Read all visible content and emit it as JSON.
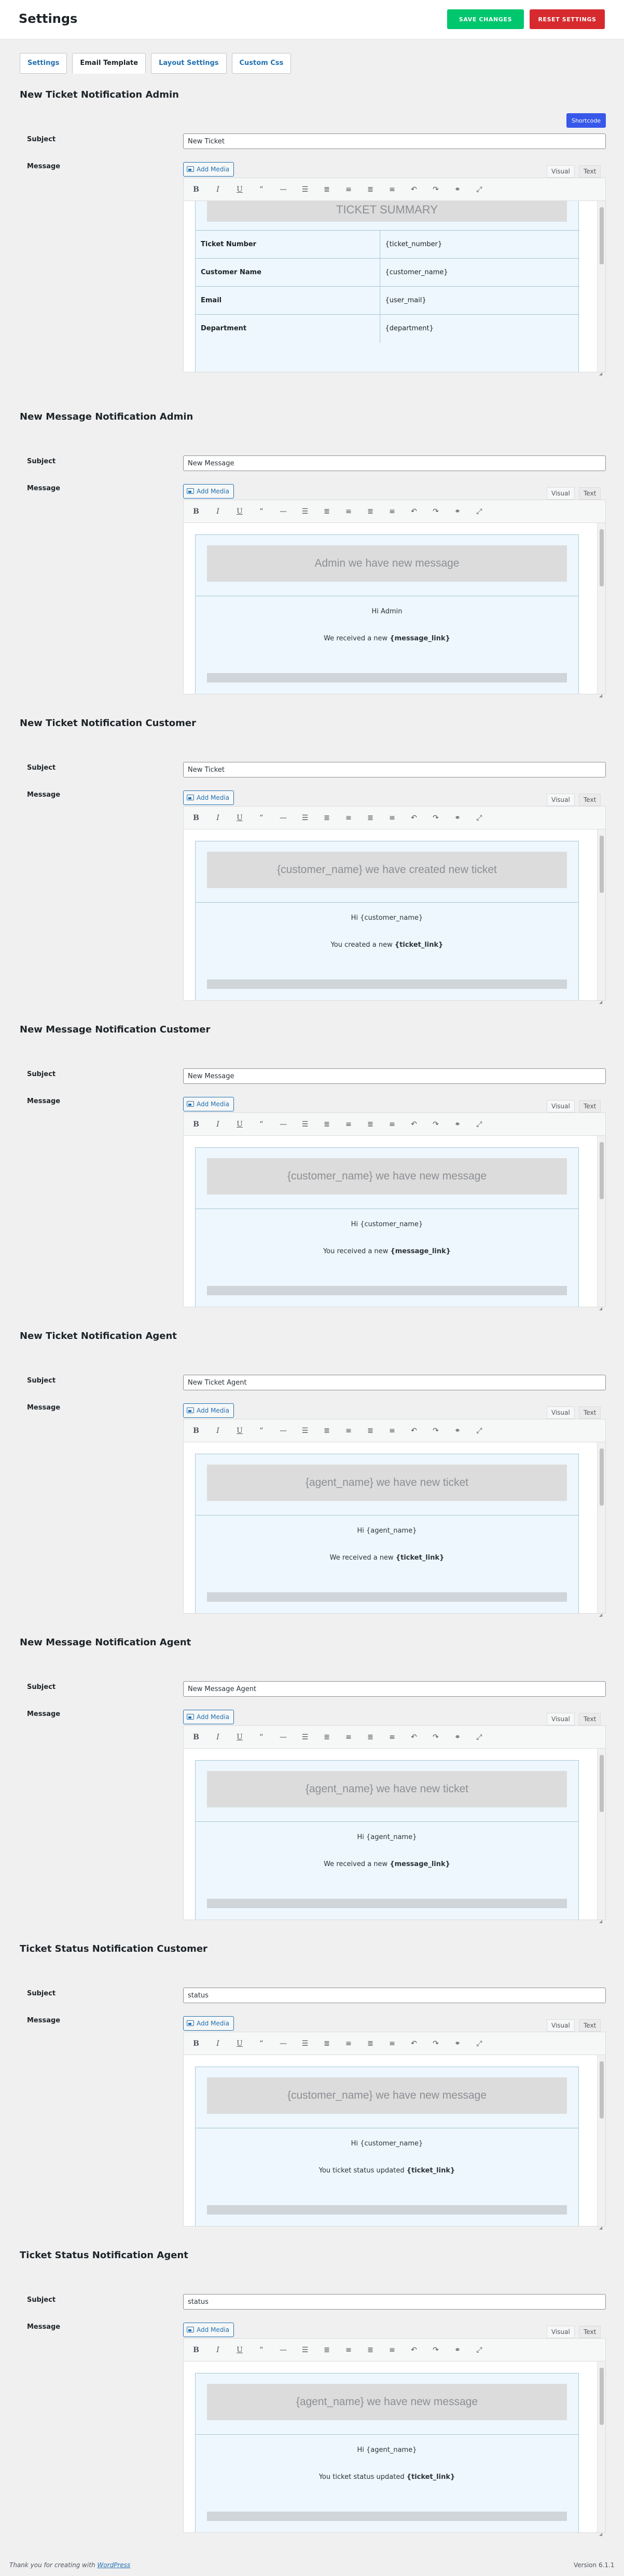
{
  "header": {
    "title": "Settings",
    "save_label": "SAVE CHANGES",
    "reset_label": "RESET SETTINGS"
  },
  "tabs": [
    {
      "label": "Settings"
    },
    {
      "label": "Email Template"
    },
    {
      "label": "Layout Settings"
    },
    {
      "label": "Custom Css"
    }
  ],
  "shortcode_label": "Shortcode",
  "labels": {
    "subject": "Subject",
    "message": "Message",
    "add_media": "Add Media",
    "visual": "Visual",
    "text": "Text"
  },
  "summary": {
    "title": "TICKET SUMMARY",
    "rows": [
      {
        "key": "Ticket Number",
        "value": "{ticket_number}"
      },
      {
        "key": "Customer Name",
        "value": "{customer_name}"
      },
      {
        "key": "Email",
        "value": "{user_mail}"
      },
      {
        "key": "Department",
        "value": "{department}"
      }
    ]
  },
  "sections": [
    {
      "title": "New Ticket Notification Admin",
      "subject": "New Ticket",
      "banner": "",
      "greeting": "",
      "body_prefix": "",
      "body_link": ""
    },
    {
      "title": "New Message Notification Admin",
      "subject": "New Message",
      "banner": "Admin we have new message",
      "greeting": "Hi Admin",
      "body_prefix": "We received a new",
      "body_link": "{message_link}"
    },
    {
      "title": "New Ticket Notification Customer",
      "subject": "New Ticket",
      "banner": "{customer_name} we have created new ticket",
      "greeting": "Hi {customer_name}",
      "body_prefix": "You created a new",
      "body_link": "{ticket_link}"
    },
    {
      "title": "New Message Notification Customer",
      "subject": "New Message",
      "banner": "{customer_name} we have  new message",
      "greeting": "Hi {customer_name}",
      "body_prefix": "You received a new",
      "body_link": "{message_link}"
    },
    {
      "title": "New Ticket Notification Agent",
      "subject": "New Ticket Agent",
      "banner": "{agent_name} we have new ticket",
      "greeting": "Hi {agent_name}",
      "body_prefix": "We received a new",
      "body_link": "{ticket_link}"
    },
    {
      "title": "New Message Notification Agent",
      "subject": "New Message Agent",
      "banner": "{agent_name} we have new ticket",
      "greeting": "Hi {agent_name}",
      "body_prefix": "We received a new",
      "body_link": "{message_link}"
    },
    {
      "title": "Ticket Status Notification Customer",
      "subject": "status",
      "banner": "{customer_name} we have  new message",
      "greeting": "Hi {customer_name}",
      "body_prefix": "You ticket status updated",
      "body_link": "{ticket_link}"
    },
    {
      "title": "Ticket Status Notification Agent",
      "subject": "status",
      "banner": "{agent_name} we have  new message",
      "greeting": "Hi {agent_name}",
      "body_prefix": "You ticket status updated",
      "body_link": "{ticket_link}"
    }
  ],
  "toolbar_icons": [
    "bold-icon",
    "italic-icon",
    "underline-icon",
    "blockquote-icon",
    "horizontal-rule-icon",
    "bullet-list-icon",
    "numbered-list-icon",
    "align-left-icon",
    "align-center-icon",
    "align-right-icon",
    "undo-icon",
    "redo-icon",
    "link-icon",
    "fullscreen-icon"
  ],
  "footer": {
    "thanks_prefix": "Thank you for creating with",
    "thanks_link": "WordPress",
    "version": "Version 6.1.1"
  },
  "colors": {
    "save": "#00c66e",
    "reset": "#d62a2f",
    "shortcode": "#3858e9",
    "link": "#2271b1"
  }
}
